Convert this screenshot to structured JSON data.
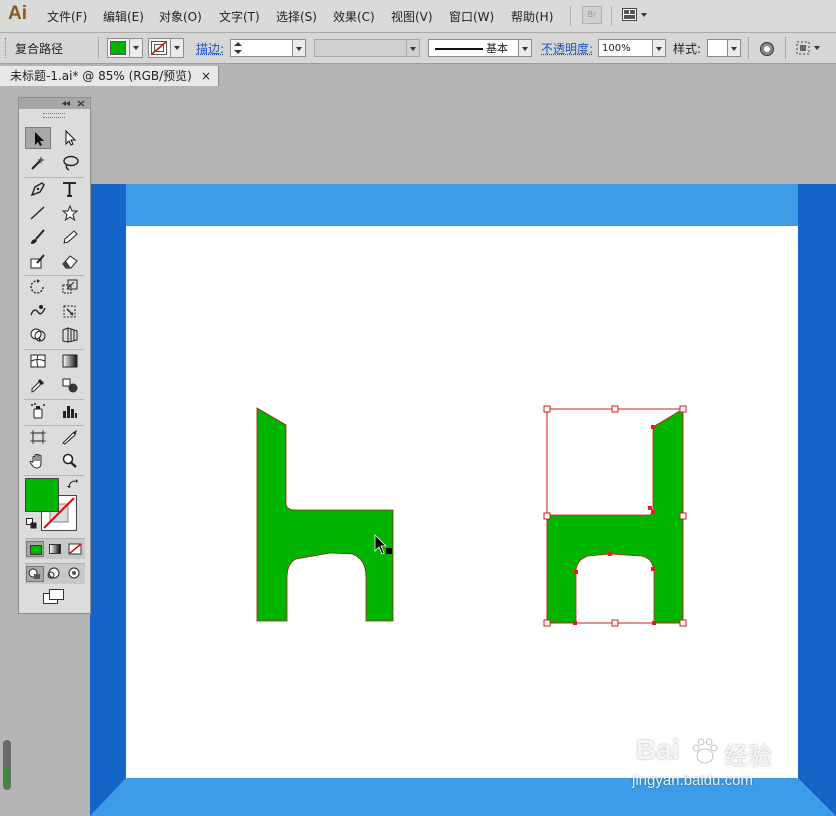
{
  "app": {
    "logo": "Ai"
  },
  "menu": [
    {
      "label": "文件(F)"
    },
    {
      "label": "编辑(E)"
    },
    {
      "label": "对象(O)"
    },
    {
      "label": "文字(T)"
    },
    {
      "label": "选择(S)"
    },
    {
      "label": "效果(C)"
    },
    {
      "label": "视图(V)"
    },
    {
      "label": "窗口(W)"
    },
    {
      "label": "帮助(H)"
    }
  ],
  "bridge_label": "Br",
  "control_bar": {
    "object_type": "复合路径",
    "fill_color": "#00b400",
    "stroke_label": "描边:",
    "stroke_style": "基本",
    "opacity_label": "不透明度:",
    "opacity_value": "100%",
    "style_label": "样式:"
  },
  "document_tab": {
    "title": "未标题-1.ai* @ 85% (RGB/预览)",
    "close": "×"
  },
  "colors": {
    "fill_green": "#00b400",
    "stroke_red": "#c81e1e",
    "frame_light": "#3c9ce8",
    "frame_dark": "#1565c8"
  },
  "tools": {
    "fill_swatch_color": "#00b400",
    "icons": [
      "selection-tool",
      "direct-selection-tool",
      "magic-wand-tool",
      "lasso-tool",
      "pen-tool",
      "type-tool",
      "line-tool",
      "star-tool",
      "paintbrush-tool",
      "pencil-tool",
      "blob-brush-tool",
      "eraser-tool",
      "rotate-tool",
      "scale-tool",
      "warp-tool",
      "free-transform-tool",
      "shape-builder-tool",
      "perspective-grid-tool",
      "mesh-tool",
      "gradient-tool",
      "eyedropper-tool",
      "blend-tool",
      "symbol-sprayer-tool",
      "column-graph-tool",
      "artboard-tool",
      "slice-tool",
      "hand-tool",
      "zoom-tool"
    ]
  },
  "watermark": {
    "brand": "Bai",
    "cn": "经验",
    "url": "jingyan.baidu.com"
  }
}
